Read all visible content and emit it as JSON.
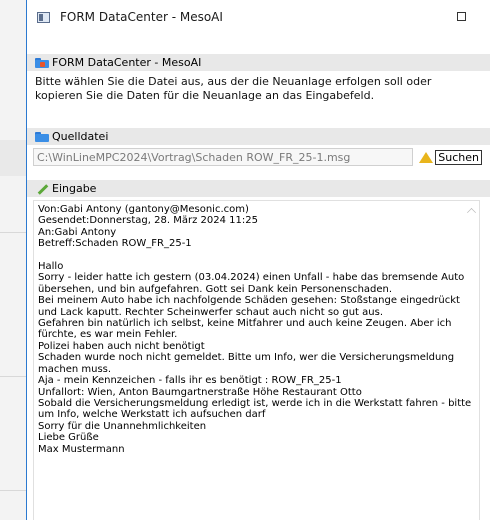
{
  "window": {
    "title": "FORM DataCenter - MesoAI"
  },
  "form_section": {
    "title": "FORM DataCenter - MesoAI",
    "description": "Bitte wählen Sie die Datei aus, aus der die Neuanlage erfolgen soll oder kopieren Sie die Daten für die Neuanlage an das Eingabefeld."
  },
  "source_section": {
    "title": "Quelldatei",
    "path": "C:\\WinLineMPC2024\\Vortrag\\Schaden ROW_FR_25-1.msg",
    "search_label": "Suchen"
  },
  "input_section": {
    "title": "Eingabe",
    "content": "Von:Gabi Antony (gantony@Mesonic.com)\nGesendet:Donnerstag, 28. März 2024 11:25\nAn:Gabi Antony\nBetreff:Schaden ROW_FR_25-1\n\nHallo\nSorry - leider hatte ich gestern (03.04.2024) einen Unfall - habe das bremsende Auto übersehen, und bin aufgefahren. Gott sei Dank kein Personenschaden.\nBei meinem Auto habe ich nachfolgende Schäden gesehen: Stoßstange eingedrückt und Lack kaputt. Rechter Scheinwerfer schaut auch nicht so gut aus.\nGefahren bin natürlich ich selbst, keine Mitfahrer und auch keine Zeugen. Aber ich fürchte, es war mein Fehler.\nPolizei haben auch nicht benötigt\nSchaden wurde noch nicht gemeldet. Bitte um Info, wer die Versicherungsmeldung machen muss.\nAja - mein Kennzeichen - falls ihr es benötigt : ROW_FR_25-1\nUnfallort: Wien, Anton Baumgartnerstraße Höhe Restaurant Otto\nSobald die Versicherungsmeldung erledigt ist, werde ich in die Werkstatt fahren - bitte um Info, welche Werkstatt ich aufsuchen darf\nSorry für die Unannehmlichkeiten\nLiebe Grüße\nMax Mustermann"
  },
  "colors": {
    "accent": "#2b79d0",
    "section_bg": "#e8e8e8",
    "path_text": "#7a7a7a"
  }
}
